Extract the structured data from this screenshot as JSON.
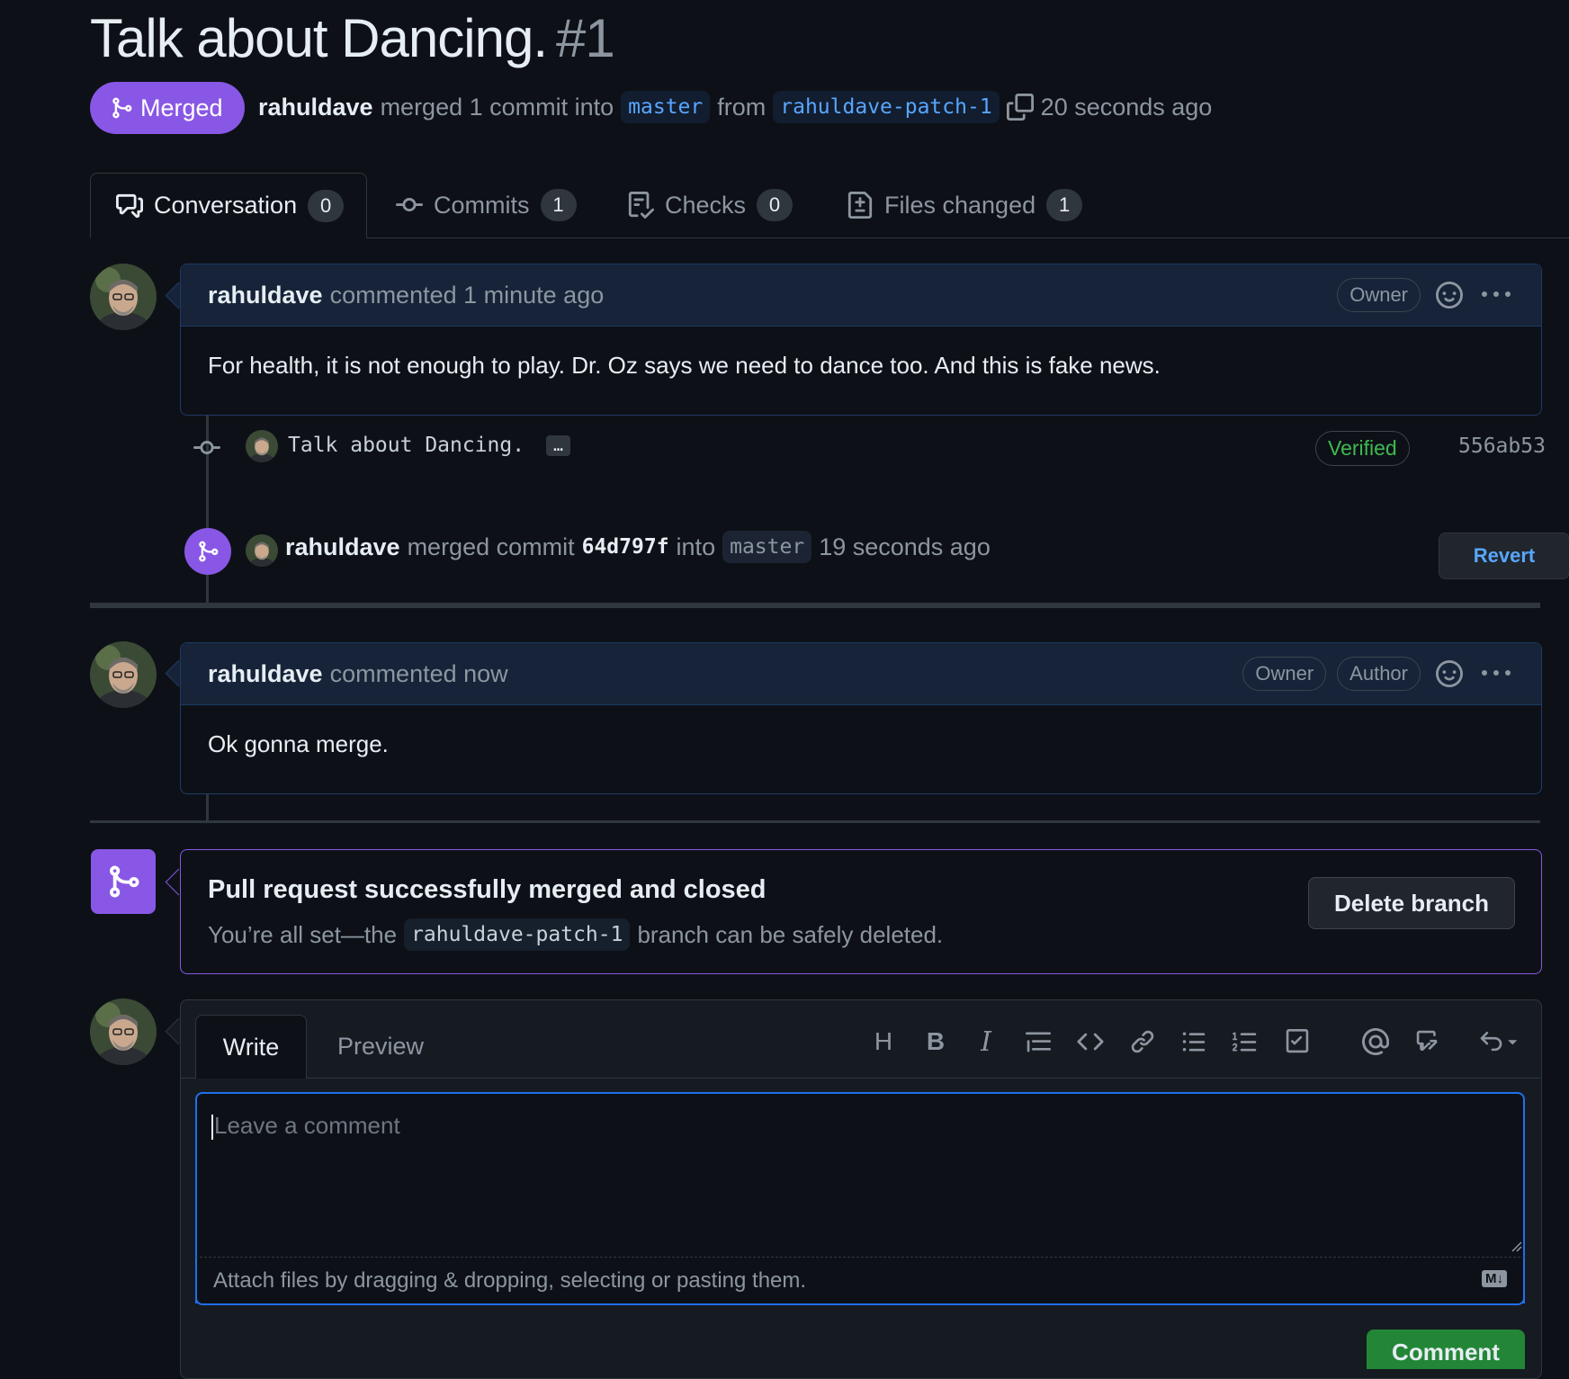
{
  "pr": {
    "title": "Talk about Dancing.",
    "number": "#1",
    "state": "Merged",
    "author": "rahuldave",
    "merged_text": "merged 1 commit into",
    "base_branch": "master",
    "from_text": "from",
    "head_branch": "rahuldave-patch-1",
    "time": "20 seconds ago"
  },
  "tabs": [
    {
      "label": "Conversation",
      "count": "0",
      "icon": "comment-discussion-icon"
    },
    {
      "label": "Commits",
      "count": "1",
      "icon": "git-commit-icon"
    },
    {
      "label": "Checks",
      "count": "0",
      "icon": "checklist-icon"
    },
    {
      "label": "Files changed",
      "count": "1",
      "icon": "file-diff-icon"
    }
  ],
  "comment1": {
    "user": "rahuldave",
    "action": "commented 1 minute ago",
    "labels": [
      "Owner"
    ],
    "body": "For health, it is not enough to play. Dr. Oz says we need to dance too. And this is fake news."
  },
  "commit": {
    "message": "Talk about Dancing.",
    "ellipsis": "…",
    "verified": "Verified",
    "sha": "556ab53"
  },
  "merge_event": {
    "user": "rahuldave",
    "text1": "merged commit",
    "sha": "64d797f",
    "text2": "into",
    "branch": "master",
    "time": "19 seconds ago",
    "revert": "Revert"
  },
  "comment2": {
    "user": "rahuldave",
    "action": "commented now",
    "labels": [
      "Owner",
      "Author"
    ],
    "body": "Ok gonna merge."
  },
  "merged_box": {
    "title": "Pull request successfully merged and closed",
    "text1": "You’re all set—the",
    "branch": "rahuldave-patch-1",
    "text2": "branch can be safely deleted.",
    "delete_button": "Delete branch"
  },
  "editor": {
    "tab_write": "Write",
    "tab_preview": "Preview",
    "placeholder": "Leave a comment",
    "attach_text": "Attach files by dragging & dropping, selecting or pasting them.",
    "markdown_badge": "M↓",
    "submit": "Comment"
  },
  "colors": {
    "accent_merged": "#8957e5",
    "link_blue": "#58a6ff",
    "verified_green": "#3fb950",
    "comment_green": "#238636",
    "background": "#0d1117"
  }
}
